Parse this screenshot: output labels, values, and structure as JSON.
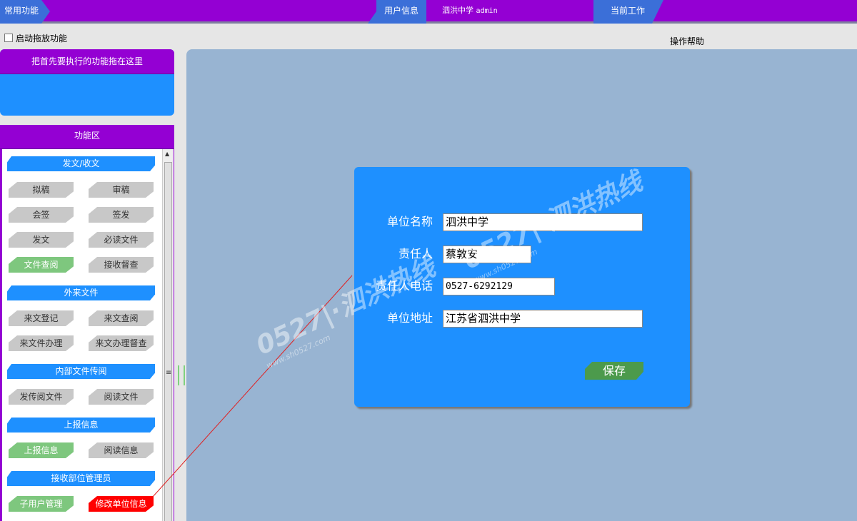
{
  "topbar": {
    "tab_common": "常用功能",
    "tab_user_info": "用户信息",
    "user_name": "泗洪中学",
    "user_role": "admin",
    "tab_current_work": "当前工作"
  },
  "drag_toggle_label": "启动拖放功能",
  "help_label": "操作帮助",
  "priority_panel_title": "把首先要执行的功能拖在这里",
  "function_panel_title": "功能区",
  "groups": [
    {
      "title": "发文/收文",
      "buttons": [
        "拟稿",
        "审稿",
        "会签",
        "签发",
        "发文",
        "必读文件",
        "文件查阅",
        "接收督查"
      ]
    },
    {
      "title": "外来文件",
      "buttons": [
        "来文登记",
        "来文查阅",
        "来文件办理",
        "来文办理督查"
      ]
    },
    {
      "title": "内部文件传阅",
      "buttons": [
        "发传阅文件",
        "阅读文件"
      ]
    },
    {
      "title": "上报信息",
      "buttons": [
        "上报信息",
        "阅读信息"
      ]
    },
    {
      "title": "接收部位管理员",
      "buttons": [
        "子用户管理",
        "修改单位信息"
      ]
    }
  ],
  "dialog": {
    "unit_name_label": "单位名称",
    "unit_name_value": "泗洪中学",
    "person_label": "责任人",
    "person_value": "蔡敦安",
    "phone_label": "责任人电话",
    "phone_value": "0527-6292129",
    "address_label": "单位地址",
    "address_value": "江苏省泗洪中学",
    "save_label": "保存"
  },
  "watermark": {
    "main": "0527|·泗洪热线",
    "url": "www.sh0527.com"
  },
  "colors": {
    "purple": "#9400d3",
    "blue": "#1e90ff",
    "workarea": "#98b4d2",
    "green_button": "#7ec77e",
    "red_button": "#ff0000"
  }
}
